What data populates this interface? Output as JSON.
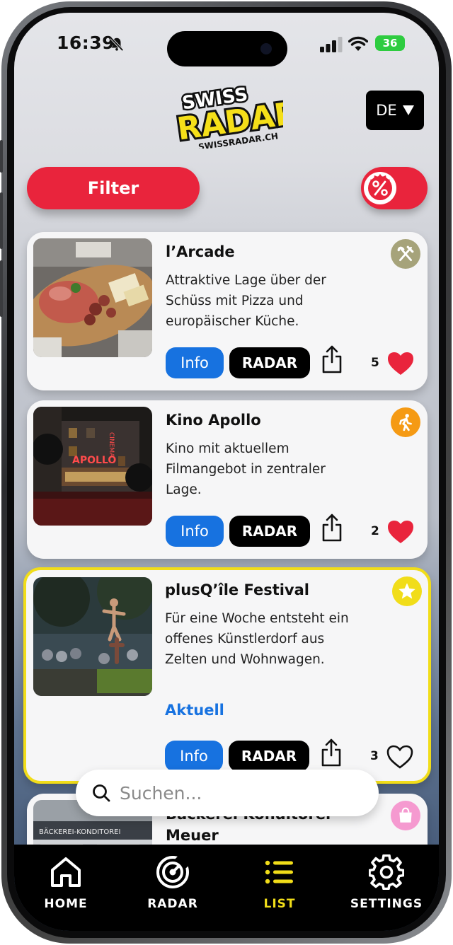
{
  "status_bar": {
    "time": "16:39",
    "battery": "36"
  },
  "header": {
    "logo_text_top": "SWISS",
    "logo_text_main": "RADAR",
    "logo_text_sub": "SWISSRADAR.CH",
    "language": "DE"
  },
  "filter_label": "Filter",
  "deals_toggle_icon": "percent-badge-icon",
  "cards": [
    {
      "title": "l’Arcade",
      "description": "Attraktive Lage über der Schüss mit Pizza und europäischer Küche.",
      "category_icon": "fork-knife-icon",
      "category_color": "#a6a37a",
      "info_label": "Info",
      "radar_label": "RADAR",
      "likes": "5",
      "liked": true
    },
    {
      "title": "Kino Apollo",
      "description": "Kino mit aktuellem Filmangebot in zentraler Lage.",
      "category_icon": "walking-person-icon",
      "category_color": "#f59a14",
      "info_label": "Info",
      "radar_label": "RADAR",
      "likes": "2",
      "liked": true
    },
    {
      "title": "plusQ’île Festival",
      "description": "Für eine Woche entsteht ein offenes Künstlerdorf aus Zelten und Wohnwagen.",
      "category_icon": "star-icon",
      "category_color": "#f1dd19",
      "status_label": "Aktuell",
      "info_label": "Info",
      "radar_label": "RADAR",
      "likes": "3",
      "liked": false
    },
    {
      "title": "Bäckerei Konditorei Meuer",
      "category_icon": "shopping-bag-icon",
      "category_color": "#f59ad0"
    }
  ],
  "search": {
    "placeholder": "Suchen..."
  },
  "tabs": [
    {
      "label": "HOME",
      "icon": "home-icon"
    },
    {
      "label": "RADAR",
      "icon": "radar-icon"
    },
    {
      "label": "LIST",
      "icon": "list-icon",
      "active": true
    },
    {
      "label": "SETTINGS",
      "icon": "gear-icon"
    }
  ],
  "colors": {
    "accent_red": "#e9243c",
    "accent_blue": "#1772e0",
    "accent_yellow": "#f1dd19"
  }
}
